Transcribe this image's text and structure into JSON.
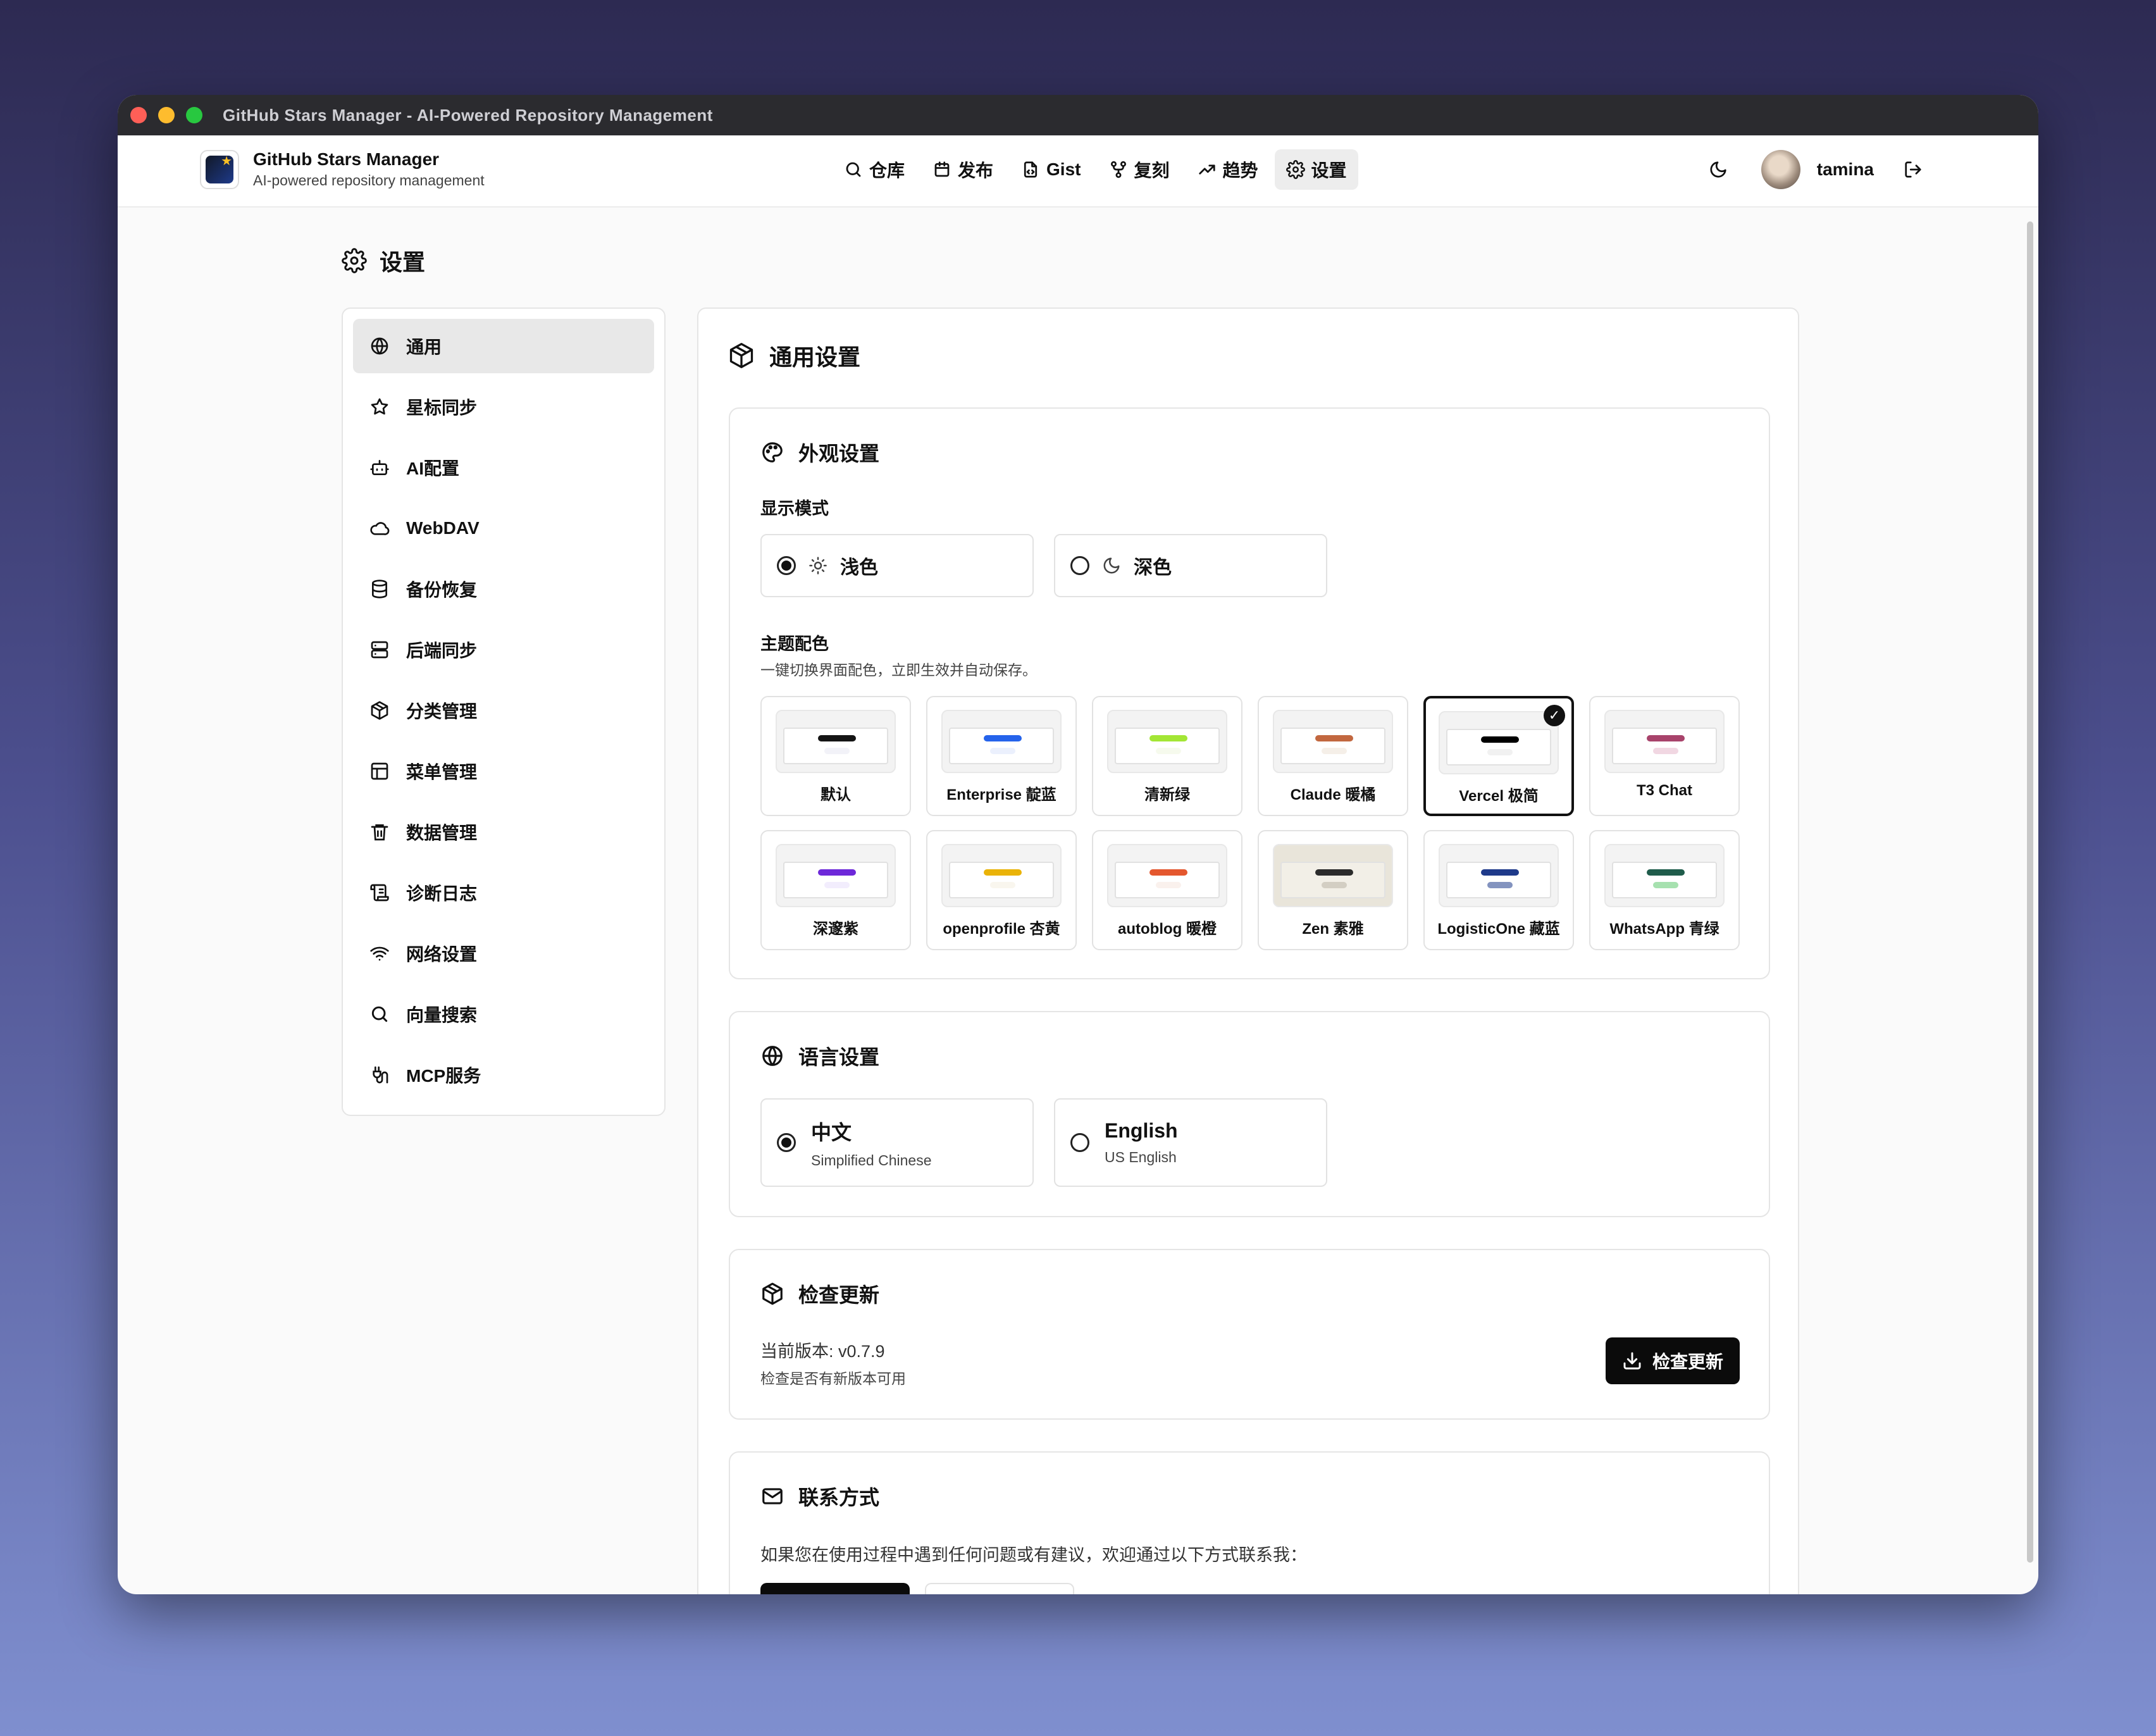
{
  "window": {
    "title": "GitHub Stars Manager - AI-Powered Repository Management"
  },
  "brand": {
    "title": "GitHub Stars Manager",
    "subtitle": "AI-powered repository management"
  },
  "nav": [
    {
      "label": "仓库",
      "icon": "search-icon"
    },
    {
      "label": "发布",
      "icon": "calendar-icon"
    },
    {
      "label": "Gist",
      "icon": "file-code-icon"
    },
    {
      "label": "复刻",
      "icon": "fork-icon"
    },
    {
      "label": "趋势",
      "icon": "trending-icon"
    },
    {
      "label": "设置",
      "icon": "gear-icon"
    }
  ],
  "user": {
    "name": "tamina"
  },
  "page": {
    "title": "设置"
  },
  "sidebar": [
    {
      "label": "通用",
      "icon": "globe-icon"
    },
    {
      "label": "星标同步",
      "icon": "star-icon"
    },
    {
      "label": "AI配置",
      "icon": "bot-icon"
    },
    {
      "label": "WebDAV",
      "icon": "cloud-icon"
    },
    {
      "label": "备份恢复",
      "icon": "database-icon"
    },
    {
      "label": "后端同步",
      "icon": "server-icon"
    },
    {
      "label": "分类管理",
      "icon": "package-icon"
    },
    {
      "label": "菜单管理",
      "icon": "layout-icon"
    },
    {
      "label": "数据管理",
      "icon": "trash-icon"
    },
    {
      "label": "诊断日志",
      "icon": "scroll-icon"
    },
    {
      "label": "网络设置",
      "icon": "wifi-icon"
    },
    {
      "label": "向量搜索",
      "icon": "search-icon"
    },
    {
      "label": "MCP服务",
      "icon": "plug-icon"
    }
  ],
  "general": {
    "title": "通用设置"
  },
  "appearance": {
    "title": "外观设置",
    "mode_label": "显示模式",
    "light": "浅色",
    "dark": "深色",
    "theme_label": "主题配色",
    "theme_hint": "一键切换界面配色，立即生效并自动保存。",
    "themes": [
      {
        "name": "默认",
        "color": "#141414",
        "accent": "#e8e8f2"
      },
      {
        "name": "Enterprise 靛蓝",
        "color": "#2563eb",
        "accent": "#dbe4fb"
      },
      {
        "name": "清新绿",
        "color": "#a3e635",
        "accent": "#eef6de"
      },
      {
        "name": "Claude 暖橘",
        "color": "#c2673f",
        "accent": "#ece2d6"
      },
      {
        "name": "Vercel 极简",
        "color": "#000000",
        "accent": "#e5e5e5"
      },
      {
        "name": "T3 Chat",
        "color": "#a8436b",
        "accent": "#e6b7cb"
      },
      {
        "name": "深邃紫",
        "color": "#6d28d9",
        "accent": "#e7dffb"
      },
      {
        "name": "openprofile 杏黄",
        "color": "#eab308",
        "accent": "#f4efe0"
      },
      {
        "name": "autoblog 暖橙",
        "color": "#e4572e",
        "accent": "#f6e5de"
      },
      {
        "name": "Zen 素雅",
        "color": "#2b2b2b",
        "accent": "#b9b3a5"
      },
      {
        "name": "LogisticOne 藏蓝",
        "color": "#1e3a8a",
        "accent": "#1e3a8a"
      },
      {
        "name": "WhatsApp 青绿",
        "color": "#1f5c4b",
        "accent": "#5cc86d"
      }
    ]
  },
  "language": {
    "title": "语言设置",
    "options": [
      {
        "main": "中文",
        "sub": "Simplified Chinese"
      },
      {
        "main": "English",
        "sub": "US English"
      }
    ]
  },
  "update": {
    "title": "检查更新",
    "version": "当前版本: v0.7.9",
    "hint": "检查是否有新版本可用",
    "button": "检查更新"
  },
  "contact": {
    "title": "联系方式",
    "text": "如果您在使用过程中遇到任何问题或有建议，欢迎通过以下方式联系我："
  }
}
